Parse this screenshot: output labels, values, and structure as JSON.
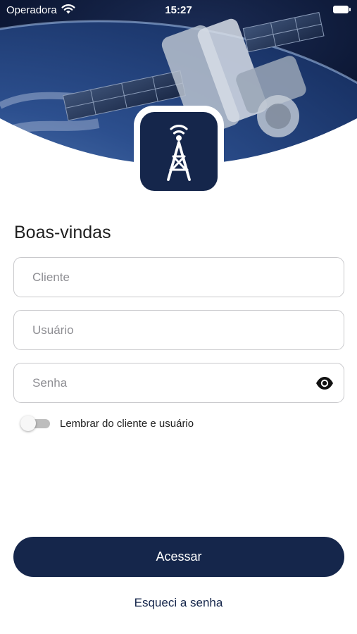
{
  "status_bar": {
    "carrier": "Operadora",
    "time": "15:27"
  },
  "hero": {
    "image": "satellite-over-earth"
  },
  "logo": {
    "icon": "antenna-tower-icon"
  },
  "login": {
    "title": "Boas-vindas",
    "client_placeholder": "Cliente",
    "user_placeholder": "Usuário",
    "password_placeholder": "Senha",
    "remember_label": "Lembrar do cliente e usuário",
    "remember_checked": false,
    "submit_label": "Acessar",
    "forgot_label": "Esqueci a senha"
  },
  "colors": {
    "brand": "#15264b",
    "field_border": "#c9c9cc",
    "placeholder": "#8e8e93"
  }
}
